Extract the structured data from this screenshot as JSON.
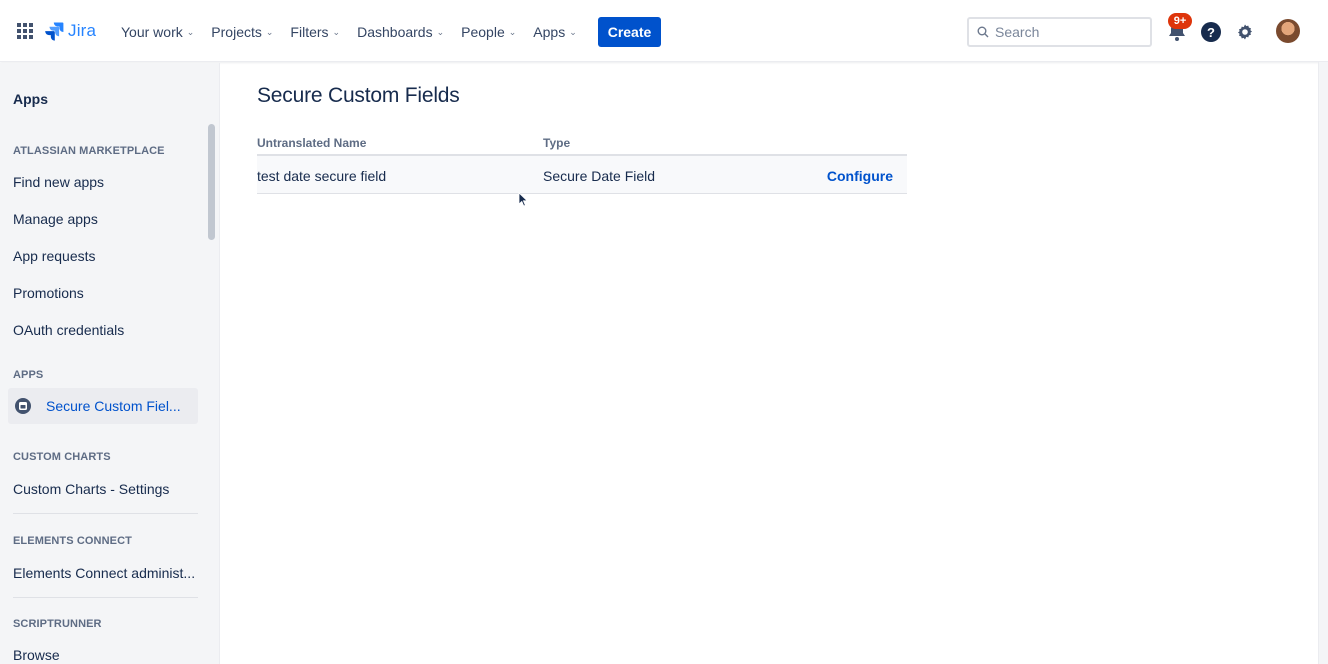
{
  "topnav": {
    "logo_text": "Jira",
    "items": [
      {
        "label": "Your work"
      },
      {
        "label": "Projects"
      },
      {
        "label": "Filters"
      },
      {
        "label": "Dashboards"
      },
      {
        "label": "People"
      },
      {
        "label": "Apps"
      }
    ],
    "create_label": "Create",
    "search_placeholder": "Search",
    "notification_badge": "9+",
    "help_glyph": "?"
  },
  "sidebar": {
    "heading": "Apps",
    "sections": {
      "marketplace": "ATLASSIAN MARKETPLACE",
      "apps": "APPS",
      "custom_charts": "CUSTOM CHARTS",
      "elements_connect": "ELEMENTS CONNECT",
      "scriptrunner": "SCRIPTRUNNER"
    },
    "items": {
      "find_new_apps": "Find new apps",
      "manage_apps": "Manage apps",
      "app_requests": "App requests",
      "promotions": "Promotions",
      "oauth_credentials": "OAuth credentials",
      "secure_custom_fields": "Secure Custom Fiel...",
      "custom_charts_settings": "Custom Charts - Settings",
      "elements_connect_admin": "Elements Connect administ...",
      "browse": "Browse"
    }
  },
  "main": {
    "title": "Secure Custom Fields",
    "table": {
      "headers": {
        "name": "Untranslated Name",
        "type": "Type"
      },
      "rows": [
        {
          "name": "test date secure field",
          "type": "Secure Date Field",
          "action": "Configure"
        }
      ]
    }
  },
  "colors": {
    "brand": "#0052cc",
    "logo": "#2684ff",
    "badge": "#de350b",
    "sidebar_bg": "#f4f5f7"
  },
  "icons": [
    "app-switcher-icon",
    "jira-logo-icon",
    "chevron-down-icon",
    "search-icon",
    "notification-icon",
    "help-icon",
    "settings-icon",
    "avatar",
    "secure-field-app-icon",
    "mouse-cursor-icon"
  ]
}
